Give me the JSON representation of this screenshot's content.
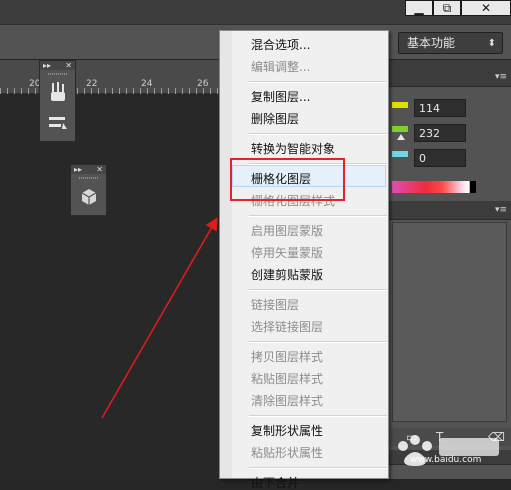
{
  "window": {
    "minimize_glyph": "▁",
    "restore_glyph": "⧉",
    "close_glyph": "✕"
  },
  "workspace": {
    "selected": "基本功能",
    "chevron": "⬍"
  },
  "ruler": {
    "ticks": [
      "20",
      "22",
      "24",
      "26"
    ]
  },
  "panels": {
    "collapse_glyph": "▸▸",
    "close_glyph": "✕",
    "panel1_tools": [
      "brush-presets-icon",
      "tool-presets-icon"
    ],
    "panel2_tools": [
      "3d-object-icon"
    ]
  },
  "color_panel": {
    "values": [
      "114",
      "232",
      "0"
    ],
    "slider_colors": [
      "#e0e000",
      "#7ecf2b",
      "#6fd6e6"
    ]
  },
  "context_menu": {
    "groups": [
      [
        {
          "label": "混合选项...",
          "enabled": true
        },
        {
          "label": "编辑调整...",
          "enabled": false
        }
      ],
      [
        {
          "label": "复制图层...",
          "enabled": true
        },
        {
          "label": "删除图层",
          "enabled": true
        }
      ],
      [
        {
          "label": "转换为智能对象",
          "enabled": true
        }
      ],
      [
        {
          "label": "栅格化图层",
          "enabled": true,
          "highlighted": true
        },
        {
          "label": "栅格化图层样式",
          "enabled": false
        }
      ],
      [
        {
          "label": "启用图层蒙版",
          "enabled": false
        },
        {
          "label": "停用矢量蒙版",
          "enabled": false
        },
        {
          "label": "创建剪贴蒙版",
          "enabled": true
        }
      ],
      [
        {
          "label": "链接图层",
          "enabled": false
        },
        {
          "label": "选择链接图层",
          "enabled": false
        }
      ],
      [
        {
          "label": "拷贝图层样式",
          "enabled": false
        },
        {
          "label": "粘贴图层样式",
          "enabled": false
        },
        {
          "label": "清除图层样式",
          "enabled": false
        }
      ],
      [
        {
          "label": "复制形状属性",
          "enabled": true
        },
        {
          "label": "粘贴形状属性",
          "enabled": false
        }
      ],
      [
        {
          "label": "由下合并",
          "enabled": true
        }
      ]
    ]
  },
  "annotation": {
    "highlight_color": "#e2242a",
    "arrow_color": "#d81e1e"
  },
  "watermark": {
    "text": "www.baidu.com"
  }
}
